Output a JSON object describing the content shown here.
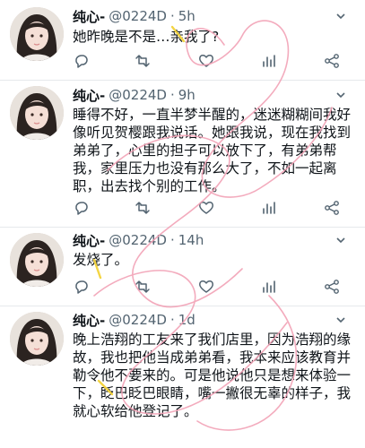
{
  "tweets": [
    {
      "name": "纯心-",
      "handle": "@0224D",
      "dot": "·",
      "time": "5h",
      "text": "她昨晚是不是…亲我了?"
    },
    {
      "name": "纯心-",
      "handle": "@0224D",
      "dot": "·",
      "time": "9h",
      "text": "睡得不好，一直半梦半醒的，迷迷糊糊间我好像听见贺樱跟我说话。她跟我说，现在我找到弟弟了，心里的担子可以放下了，有弟弟帮我，家里压力也没有那么大了，不如一起离职，出去找个别的工作。"
    },
    {
      "name": "纯心-",
      "handle": "@0224D",
      "dot": "·",
      "time": "14h",
      "text": "发烧了。"
    },
    {
      "name": "纯心-",
      "handle": "@0224D",
      "dot": "·",
      "time": "1d",
      "text": "晚上浩翔的工友来了我们店里，因为浩翔的缘故，我也把他当成弟弟看，我本来应该教育并勒令他不要来的。可是他说他只是想来体验一下，眨巴眨巴眼睛，嘴一撇很无辜的样子，我就心软给他登记了。"
    }
  ],
  "icons": [
    "reply-icon",
    "retweet-icon",
    "like-icon",
    "views-icon",
    "share-icon",
    "more-caret-icon"
  ],
  "colors": {
    "text": "#0f1419",
    "secondary": "#536471",
    "divider": "#e6e9ec",
    "scribble_pink": "#f2a2b6",
    "scribble_yellow": "#f3d33a"
  }
}
